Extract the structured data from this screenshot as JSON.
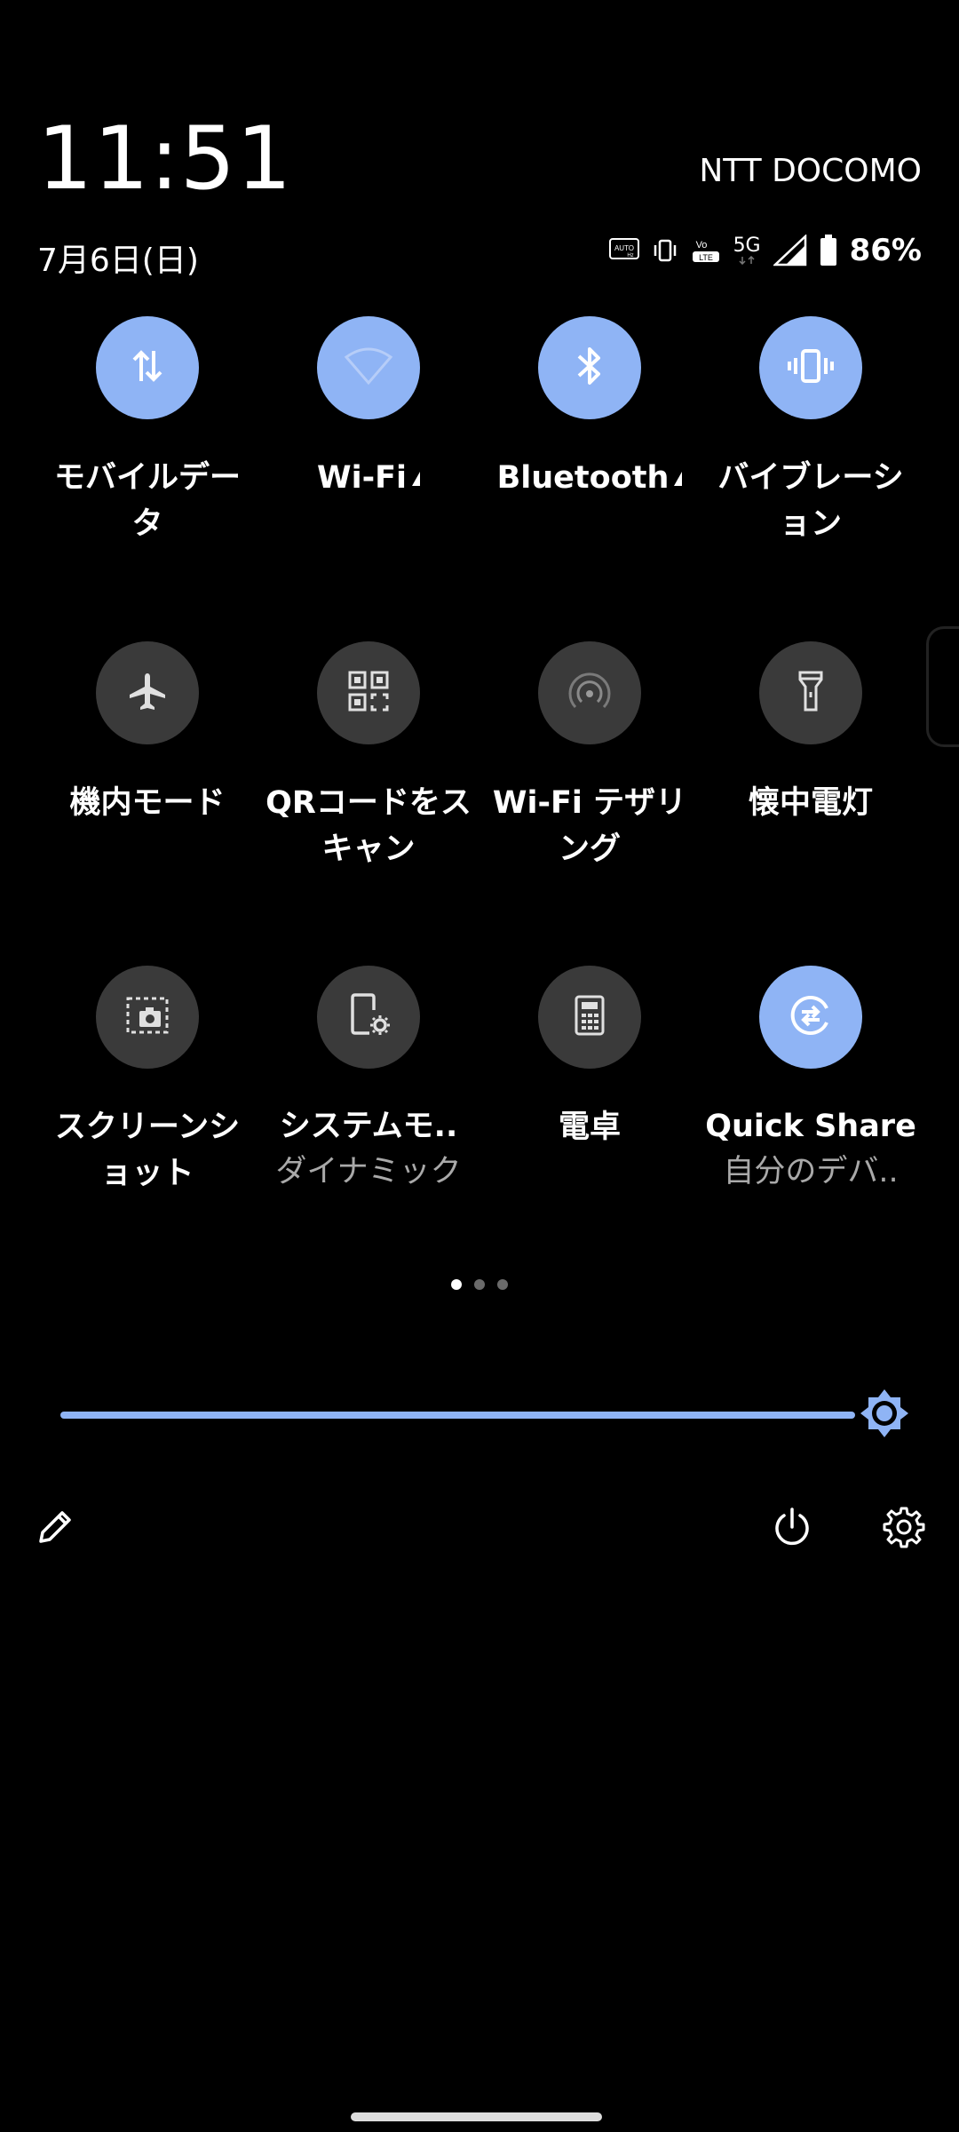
{
  "status_bar": {
    "time": "11:51",
    "carrier": "NTT DOCOMO",
    "date": "7月6日(日)",
    "battery": "86%",
    "net_5g": "5G"
  },
  "tiles": [
    {
      "label": "モバイルデータ",
      "sub": "",
      "state": "on",
      "icon": "mobile-data-icon"
    },
    {
      "label": "Wi-Fi",
      "sub": "",
      "state": "on",
      "icon": "wifi-icon",
      "has_arrow": true
    },
    {
      "label": "Bluetooth",
      "sub": "",
      "state": "on",
      "icon": "bluetooth-icon",
      "has_arrow": true
    },
    {
      "label": "バイブレーション",
      "sub": "",
      "state": "on",
      "icon": "vibration-icon"
    },
    {
      "label": "機内モード",
      "sub": "",
      "state": "off",
      "icon": "airplane-icon"
    },
    {
      "label": "QRコードをスキャン",
      "sub": "",
      "state": "off",
      "icon": "qr-code-icon"
    },
    {
      "label": "Wi-Fi テザリング",
      "sub": "",
      "state": "off",
      "icon": "hotspot-icon"
    },
    {
      "label": "懐中電灯",
      "sub": "",
      "state": "off",
      "icon": "flashlight-icon"
    },
    {
      "label": "スクリーンショット",
      "sub": "",
      "state": "off",
      "icon": "screenshot-icon"
    },
    {
      "label": "システムモ..",
      "sub": "ダイナミック",
      "state": "off",
      "icon": "system-mode-icon"
    },
    {
      "label": "電卓",
      "sub": "",
      "state": "off",
      "icon": "calculator-icon"
    },
    {
      "label": "Quick Share",
      "sub": "自分のデバ..",
      "state": "on",
      "icon": "quick-share-icon"
    }
  ],
  "page_indicator": {
    "count": 3,
    "active": 0
  },
  "brightness": {
    "level": 0.97
  },
  "colors": {
    "accent": "#8fb4f5",
    "tile_off": "#3a3a3a",
    "background": "#000000"
  }
}
